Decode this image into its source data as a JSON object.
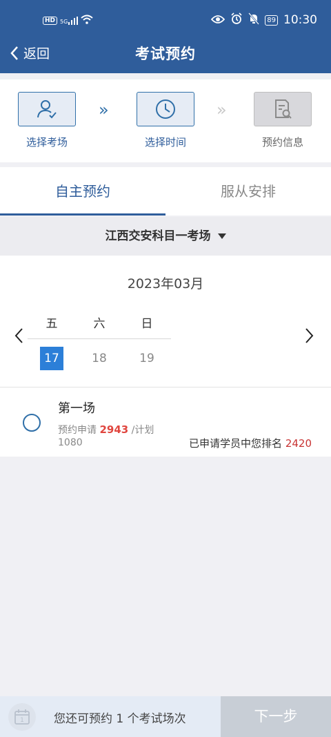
{
  "statusbar": {
    "hd": "HD",
    "signal": "5G",
    "battery": "89",
    "time": "10:30"
  },
  "header": {
    "back_label": "返回",
    "title": "考试预约"
  },
  "steps": [
    {
      "label": "选择考场",
      "icon": "user-check-icon"
    },
    {
      "label": "选择时间",
      "icon": "clock-icon"
    },
    {
      "label": "预约信息",
      "icon": "document-search-icon"
    }
  ],
  "tabs": [
    {
      "label": "自主预约"
    },
    {
      "label": "服从安排"
    }
  ],
  "venue": {
    "name": "江西交安科目一考场"
  },
  "calendar": {
    "month": "2023年03月",
    "weekdays": [
      "五",
      "六",
      "日"
    ],
    "days": [
      "17",
      "18",
      "19"
    ],
    "selected": "17"
  },
  "session": {
    "title": "第一场",
    "apply_label": "预约申请",
    "apply_count": "2943",
    "plan_label": "/计划",
    "plan_count": "1080",
    "rank_label": "已申请学员中您排名",
    "rank": "2420"
  },
  "footer": {
    "remaining_text": "您还可预约 1 个考试场次",
    "calendar_day": "1",
    "next_label": "下一步"
  },
  "colors": {
    "primary": "#2f5d9b",
    "accent": "#2c7fd8",
    "highlight": "#e0463f"
  }
}
